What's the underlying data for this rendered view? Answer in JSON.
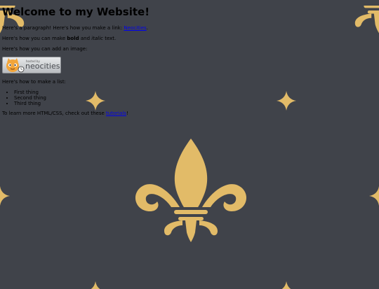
{
  "page": {
    "heading": "Welcome to my Website!",
    "intro": {
      "before_link": "Here's a paragraph! Here's how you make a link: ",
      "link_text": "Neocities",
      "after_link": "."
    },
    "formatting": {
      "before_bold": "Here's how you can make ",
      "bold_text": "bold",
      "middle": " and ",
      "italic_text": "italic",
      "after_italic": " text."
    },
    "image_intro": "Here's how you can add an image:",
    "badge": {
      "small_text": "hosted by",
      "brand_text": "neocities"
    },
    "list_intro": "Here's how to make a list:",
    "list_items": [
      "First thing",
      "Second thing",
      "Third thing"
    ],
    "outro": {
      "before_link": "To learn more HTML/CSS, check out these ",
      "link_text": "tutorials",
      "after_link": "!"
    }
  },
  "colors": {
    "background": "#40434a",
    "pattern": "#e2bb68",
    "link": "#0000ee"
  },
  "icons": {
    "background_motif": "fleur-de-lis-icon",
    "badge_mascot": "cat-mascot-icon"
  }
}
